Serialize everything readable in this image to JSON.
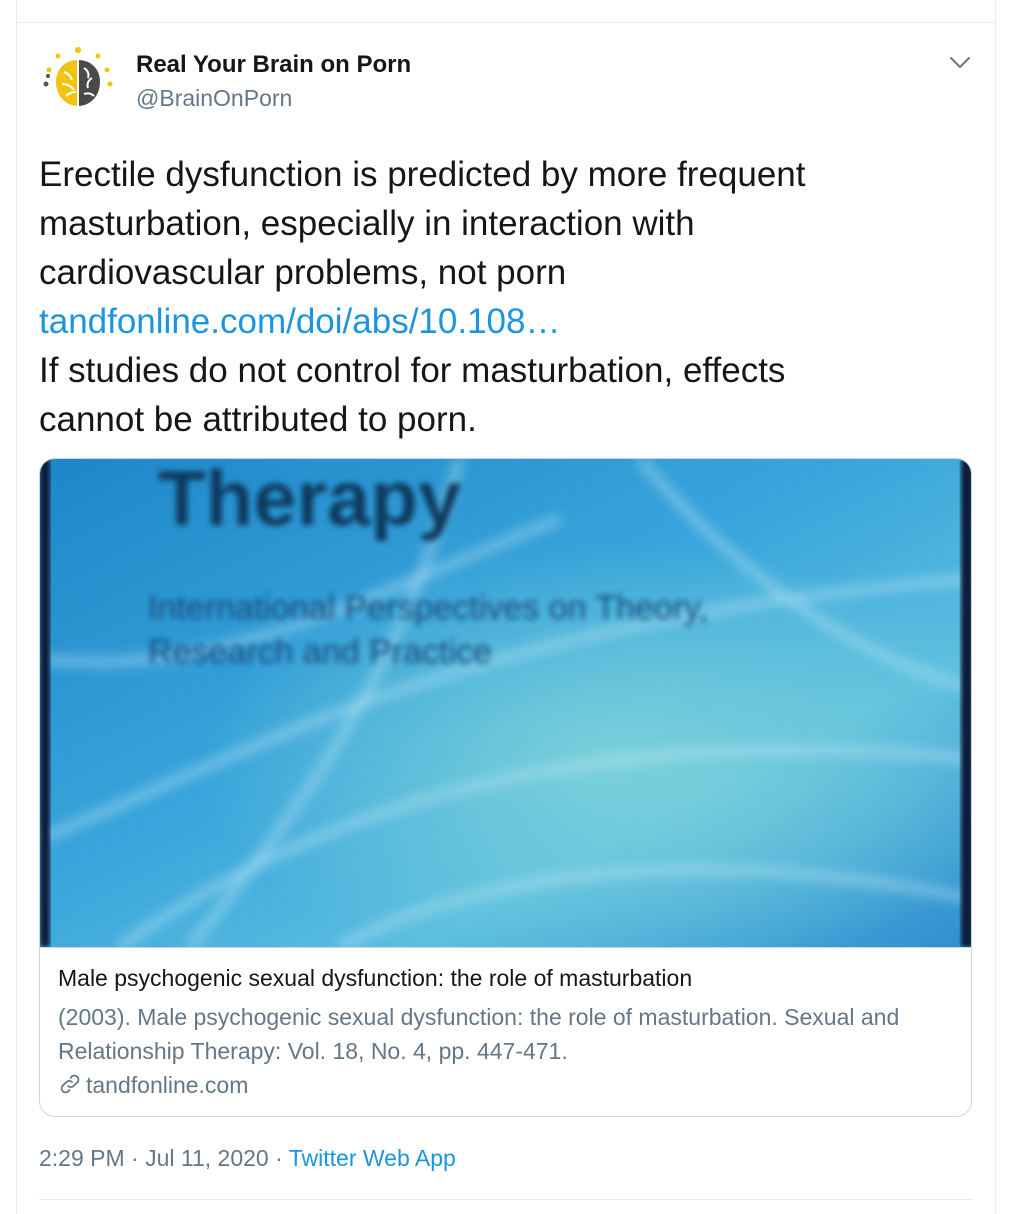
{
  "author": {
    "display_name": "Real Your Brain on Porn",
    "handle": "@BrainOnPorn",
    "avatar_icon": "brain-logo-icon"
  },
  "tweet": {
    "lines": [
      "Erectile dysfunction is predicted by more frequent",
      "masturbation, especially in interaction with",
      "cardiovascular problems, not porn"
    ],
    "link_text": "tandfonline.com/doi/abs/10.108…",
    "after_lines": [
      "If studies do not control for masturbation, effects",
      "cannot be attributed to porn."
    ]
  },
  "card": {
    "image": {
      "heading": "Therapy",
      "subtitle_line1": "International Perspectives on Theory,",
      "subtitle_line2": "Research and Practice"
    },
    "title": "Male psychogenic sexual dysfunction: the role of masturbation",
    "description_line1": "(2003). Male psychogenic sexual dysfunction: the role of masturbation. Sexual and",
    "description_line2": "Relationship Therapy: Vol. 18, No. 4, pp. 447-471.",
    "domain": "tandfonline.com",
    "domain_icon": "link-icon"
  },
  "meta": {
    "time": "2:29 PM",
    "separator1": " · ",
    "date": "Jul 11, 2020",
    "separator2": " · ",
    "source": "Twitter Web App"
  },
  "colors": {
    "link": "#1b95e0",
    "secondary_text": "#657786",
    "primary_text": "#14171a",
    "border": "#ccd6dd"
  }
}
